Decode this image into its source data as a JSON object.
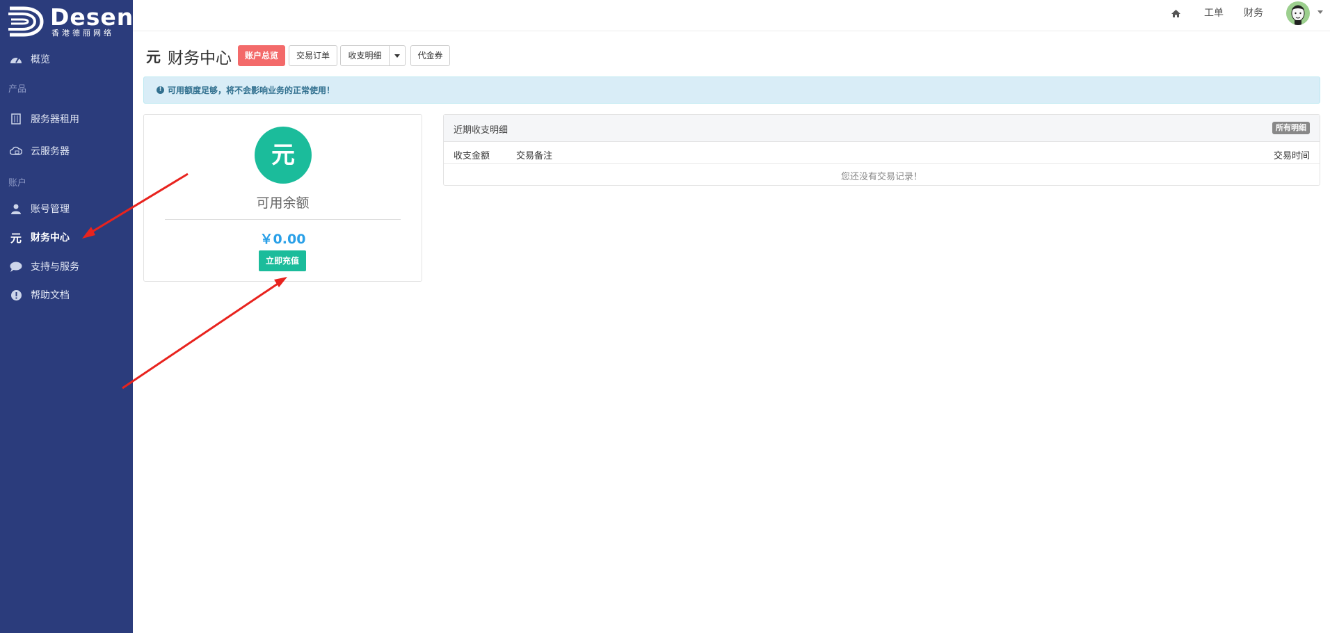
{
  "logo": {
    "name": "Desen",
    "subtitle": "香港德丽网络"
  },
  "sidebar": {
    "items": [
      {
        "label": "概览",
        "icon": "dashboard-icon"
      },
      {
        "label": "服务器租用",
        "icon": "server-icon"
      },
      {
        "label": "云服务器",
        "icon": "cloud-icon"
      },
      {
        "label": "账号管理",
        "icon": "user-icon"
      },
      {
        "label": "财务中心",
        "icon": "yuan-icon",
        "active": true
      },
      {
        "label": "支持与服务",
        "icon": "chat-icon"
      },
      {
        "label": "帮助文档",
        "icon": "exclamation-icon"
      }
    ],
    "sections": {
      "products": "产品",
      "account": "账户"
    }
  },
  "topbar": {
    "links": [
      "工单",
      "财务"
    ],
    "home_icon": "home-icon"
  },
  "page": {
    "title_icon": "元",
    "title": "财务中心"
  },
  "tabs": {
    "overview": "账户总览",
    "orders": "交易订单",
    "details": "收支明细",
    "vouchers": "代金券"
  },
  "alert": {
    "text": "可用额度足够，将不会影响业务的正常使用！"
  },
  "balance": {
    "symbol": "元",
    "label": "可用余额",
    "value": "￥0.00",
    "recharge_label": "立即充值"
  },
  "recent": {
    "title": "近期收支明细",
    "all_label": "所有明细",
    "columns": [
      "收支金额",
      "交易备注",
      "交易时间"
    ],
    "empty": "您还没有交易记录！"
  },
  "colors": {
    "sidebar": "#2b3c7c",
    "accent_green": "#1bbc9b",
    "danger": "#f36a6a",
    "alert_bg": "#d9edf7",
    "annotation_arrow": "#e8231e"
  }
}
